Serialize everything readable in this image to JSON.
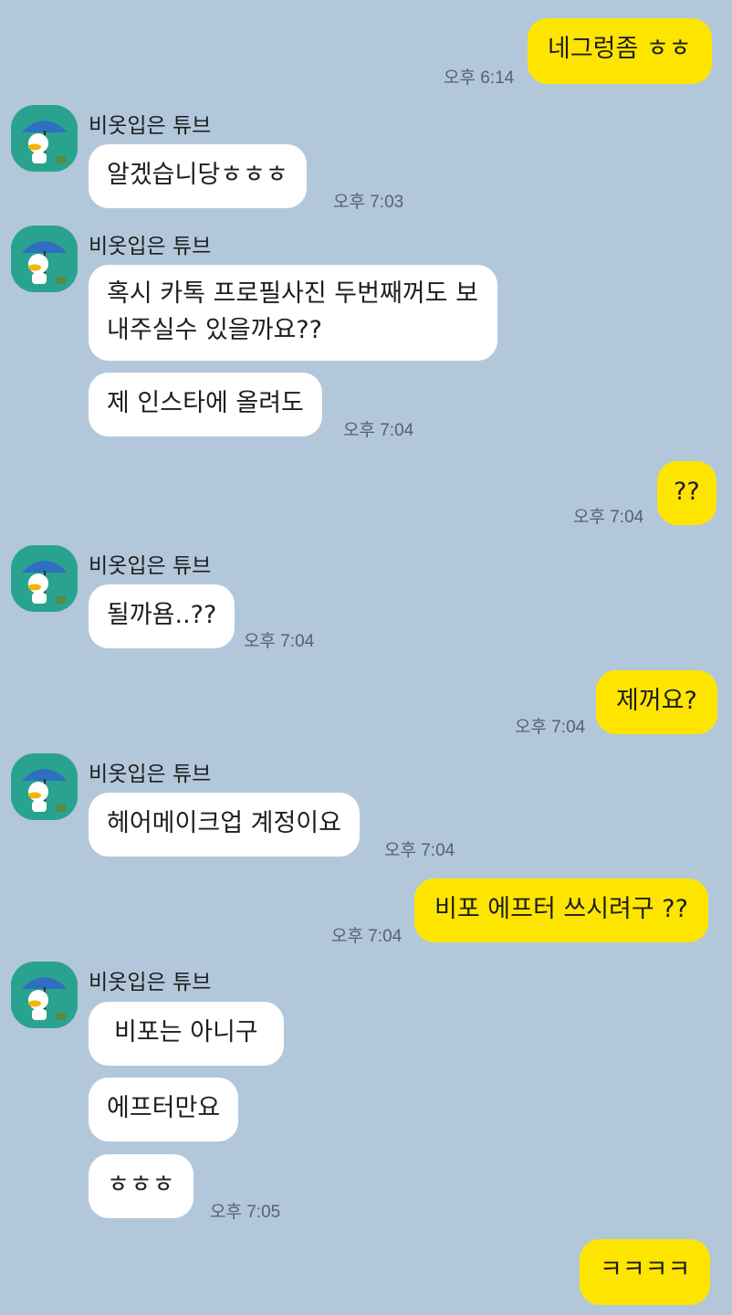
{
  "contact": {
    "name": "비옷입은 튜브"
  },
  "messages": {
    "m1": {
      "text": "네그렁좀 ㅎㅎ",
      "time": "오후 6:14"
    },
    "m2": {
      "text": "알겠습니당ㅎㅎㅎ",
      "time": "오후 7:03"
    },
    "m3": {
      "text": "혹시 카톡 프로필사진 두번째꺼도 보내주실수 있을까요??"
    },
    "m4": {
      "text": "제 인스타에 올려도",
      "time": "오후 7:04"
    },
    "m5": {
      "text": "??",
      "time": "오후 7:04"
    },
    "m6": {
      "text": "될까욤..??",
      "time": "오후 7:04"
    },
    "m7": {
      "text": "제꺼요?",
      "time": "오후 7:04"
    },
    "m8": {
      "text": "헤어메이크업 계정이요",
      "time": "오후 7:04"
    },
    "m9": {
      "text": "비포 에프터 쓰시려구 ??",
      "time": "오후 7:04"
    },
    "m10": {
      "text": "비포는 아니구"
    },
    "m11": {
      "text": "에프터만요"
    },
    "m12": {
      "text": "ㅎㅎㅎ",
      "time": "오후 7:05"
    },
    "m13": {
      "text": "ㅋㅋㅋㅋ"
    }
  },
  "colors": {
    "background": "#b2c7da",
    "outgoing_bubble": "#fee500",
    "incoming_bubble": "#ffffff",
    "avatar_bg": "#2aa38e"
  },
  "icons": {
    "avatar": "tube-duck-umbrella-avatar"
  }
}
